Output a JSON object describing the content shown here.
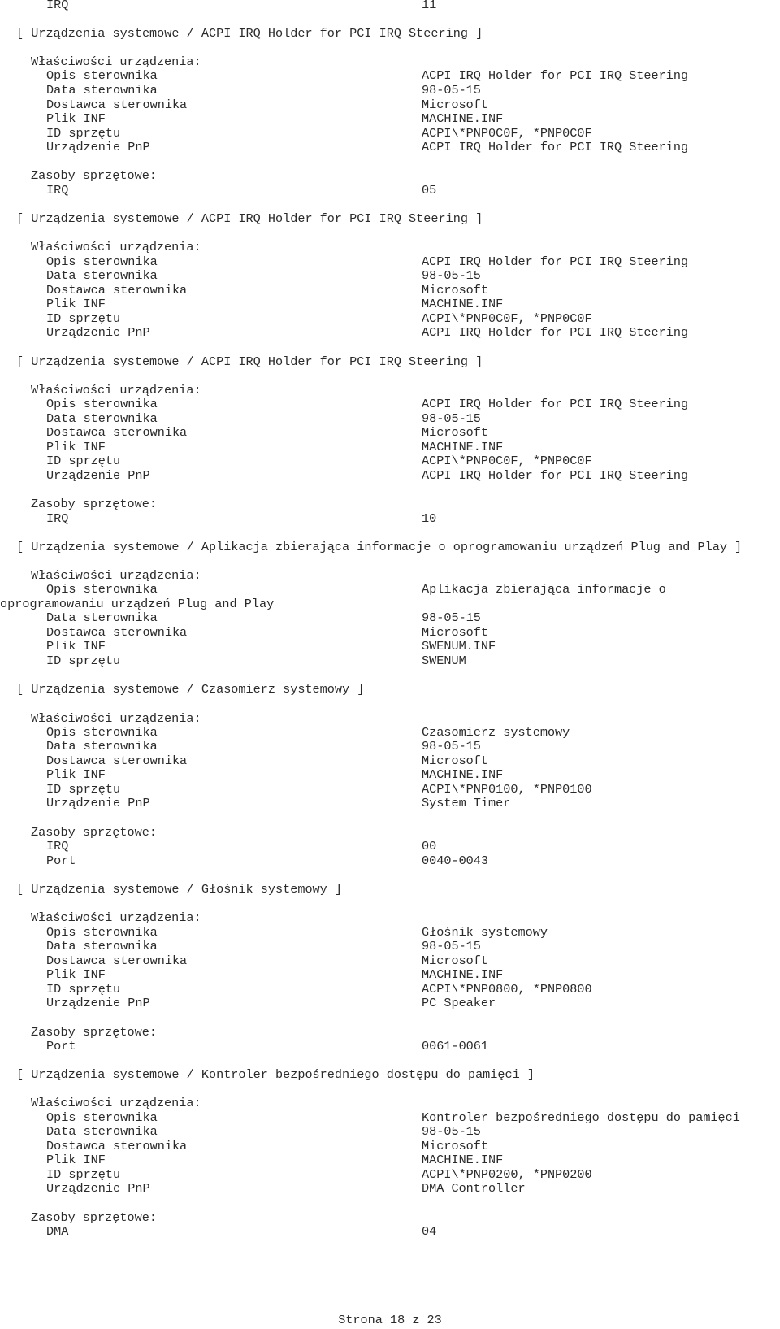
{
  "top_resource": {
    "label": "IRQ",
    "value": "11"
  },
  "group_labels": {
    "properties": "Właściwości urządzenia:",
    "resources": "Zasoby sprzętowe:"
  },
  "field_labels": {
    "description": "Opis sterownika",
    "date": "Data sterownika",
    "vendor": "Dostawca sterownika",
    "inf": "Plik INF",
    "hwid": "ID sprzętu",
    "pnp": "Urządzenie PnP"
  },
  "devices": [
    {
      "header": "[ Urządzenia systemowe / ACPI IRQ Holder for PCI IRQ Steering ]",
      "description": "ACPI IRQ Holder for PCI IRQ Steering",
      "date": "98-05-15",
      "vendor": "Microsoft",
      "inf": "MACHINE.INF",
      "hwid": "ACPI\\*PNP0C0F, *PNP0C0F",
      "pnp": "ACPI IRQ Holder for PCI IRQ Steering",
      "resources": [
        {
          "label": "IRQ",
          "value": "05"
        }
      ]
    },
    {
      "header": "[ Urządzenia systemowe / ACPI IRQ Holder for PCI IRQ Steering ]",
      "description": "ACPI IRQ Holder for PCI IRQ Steering",
      "date": "98-05-15",
      "vendor": "Microsoft",
      "inf": "MACHINE.INF",
      "hwid": "ACPI\\*PNP0C0F, *PNP0C0F",
      "pnp": "ACPI IRQ Holder for PCI IRQ Steering",
      "resources": []
    },
    {
      "header": "[ Urządzenia systemowe / ACPI IRQ Holder for PCI IRQ Steering ]",
      "description": "ACPI IRQ Holder for PCI IRQ Steering",
      "date": "98-05-15",
      "vendor": "Microsoft",
      "inf": "MACHINE.INF",
      "hwid": "ACPI\\*PNP0C0F, *PNP0C0F",
      "pnp": "ACPI IRQ Holder for PCI IRQ Steering",
      "resources": [
        {
          "label": "IRQ",
          "value": "10"
        }
      ]
    },
    {
      "header": "[ Urządzenia systemowe / Aplikacja zbierająca informacje o oprogramowaniu urządzeń Plug and Play ]",
      "description": "Aplikacja zbierająca informacje o",
      "description_wrap": "oprogramowaniu urządzeń Plug and Play",
      "date": "98-05-15",
      "vendor": "Microsoft",
      "inf": "SWENUM.INF",
      "hwid": "SWENUM",
      "resources": []
    },
    {
      "header": "[ Urządzenia systemowe / Czasomierz systemowy ]",
      "description": "Czasomierz systemowy",
      "date": "98-05-15",
      "vendor": "Microsoft",
      "inf": "MACHINE.INF",
      "hwid": "ACPI\\*PNP0100, *PNP0100",
      "pnp": "System Timer",
      "resources": [
        {
          "label": "IRQ",
          "value": "00"
        },
        {
          "label": "Port",
          "value": "0040-0043"
        }
      ]
    },
    {
      "header": "[ Urządzenia systemowe / Głośnik systemowy ]",
      "description": "Głośnik systemowy",
      "date": "98-05-15",
      "vendor": "Microsoft",
      "inf": "MACHINE.INF",
      "hwid": "ACPI\\*PNP0800, *PNP0800",
      "pnp": "PC Speaker",
      "resources": [
        {
          "label": "Port",
          "value": "0061-0061"
        }
      ]
    },
    {
      "header": "[ Urządzenia systemowe / Kontroler bezpośredniego dostępu do pamięci ]",
      "description": "Kontroler bezpośredniego dostępu do pamięci",
      "date": "98-05-15",
      "vendor": "Microsoft",
      "inf": "MACHINE.INF",
      "hwid": "ACPI\\*PNP0200, *PNP0200",
      "pnp": "DMA Controller",
      "resources": [
        {
          "label": "DMA",
          "value": "04"
        }
      ]
    }
  ],
  "footer": {
    "page_label": "Strona 18 z 23"
  }
}
